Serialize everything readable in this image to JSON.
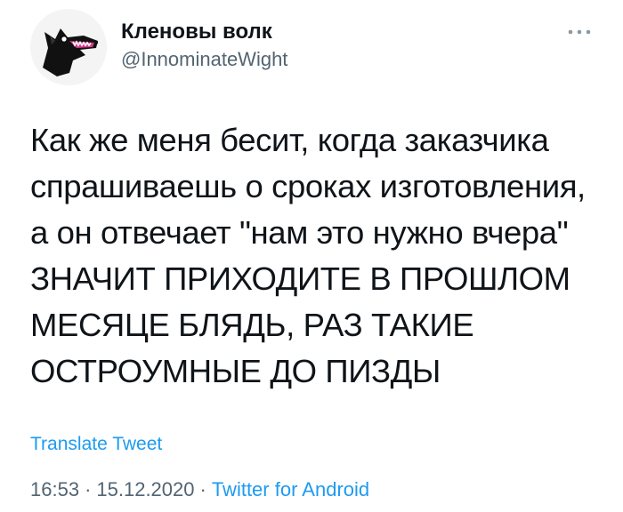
{
  "author": {
    "display_name": "Кленовы волк",
    "handle": "@InnominateWight",
    "avatar_icon": "wolf-head-avatar"
  },
  "more_icon": "more-dots-icon",
  "tweet": {
    "lines": [
      "Как же меня бесит, когда заказчика",
      "спрашиваешь о сроках изготовления,",
      "а он отвечает \"нам это нужно вчера\"",
      "ЗНАЧИТ ПРИХОДИТЕ В ПРОШЛОМ",
      "МЕСЯЦЕ БЛЯДЬ, РАЗ ТАКИЕ",
      "ОСТРОУМНЫЕ ДО ПИЗДЫ"
    ]
  },
  "translate_label": "Translate Tweet",
  "meta": {
    "time": "16:53",
    "separator": "·",
    "date": "15.12.2020",
    "source": "Twitter for Android"
  },
  "colors": {
    "accent": "#1d9bf0",
    "secondary_text": "#536471",
    "primary_text": "#0f1419"
  }
}
